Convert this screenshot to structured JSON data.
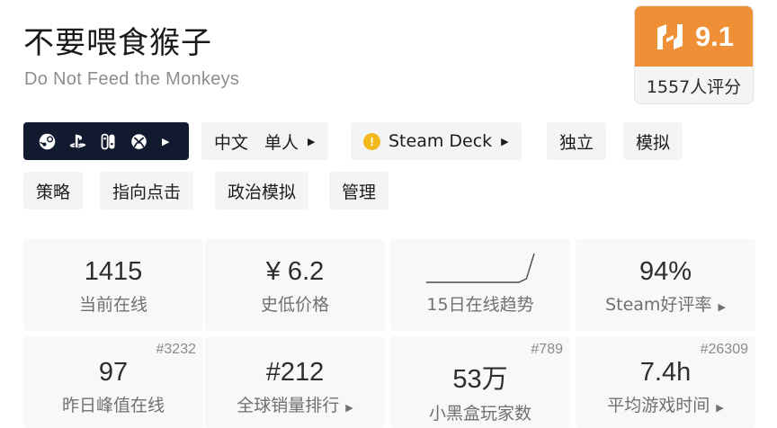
{
  "game": {
    "title": "不要喂食猴子",
    "subtitle": "Do Not Feed the Monkeys"
  },
  "score": {
    "value": "9.1",
    "count": "1557人评分",
    "color": "#f09036"
  },
  "platforms": [
    "steam-icon",
    "playstation-icon",
    "switch-icon",
    "xbox-icon"
  ],
  "tags": {
    "language": "中文",
    "mode": "单人",
    "steam_deck": "Steam Deck",
    "items": [
      "独立",
      "模拟",
      "策略",
      "指向点击",
      "政治模拟",
      "管理"
    ]
  },
  "stats": {
    "online_now": {
      "value": "1415",
      "label": "当前在线"
    },
    "lowest_price": {
      "value": "¥ 6.2",
      "label": "史低价格"
    },
    "trend": {
      "label": "15日在线趋势",
      "series": [
        1,
        1,
        1,
        1,
        1,
        1,
        1,
        1,
        1,
        1,
        1,
        1,
        1,
        2,
        9
      ]
    },
    "steam_rating": {
      "value": "94%",
      "label": "Steam好评率"
    },
    "peak_yesterday": {
      "value": "97",
      "label": "昨日峰值在线",
      "rank": "#3232"
    },
    "global_sales": {
      "value": "#212",
      "label": "全球销量排行"
    },
    "heybox_players": {
      "value": "53万",
      "label": "小黑盒玩家数",
      "rank": "#789"
    },
    "avg_playtime": {
      "value": "7.4h",
      "label": "平均游戏时间",
      "rank": "#26309"
    }
  }
}
